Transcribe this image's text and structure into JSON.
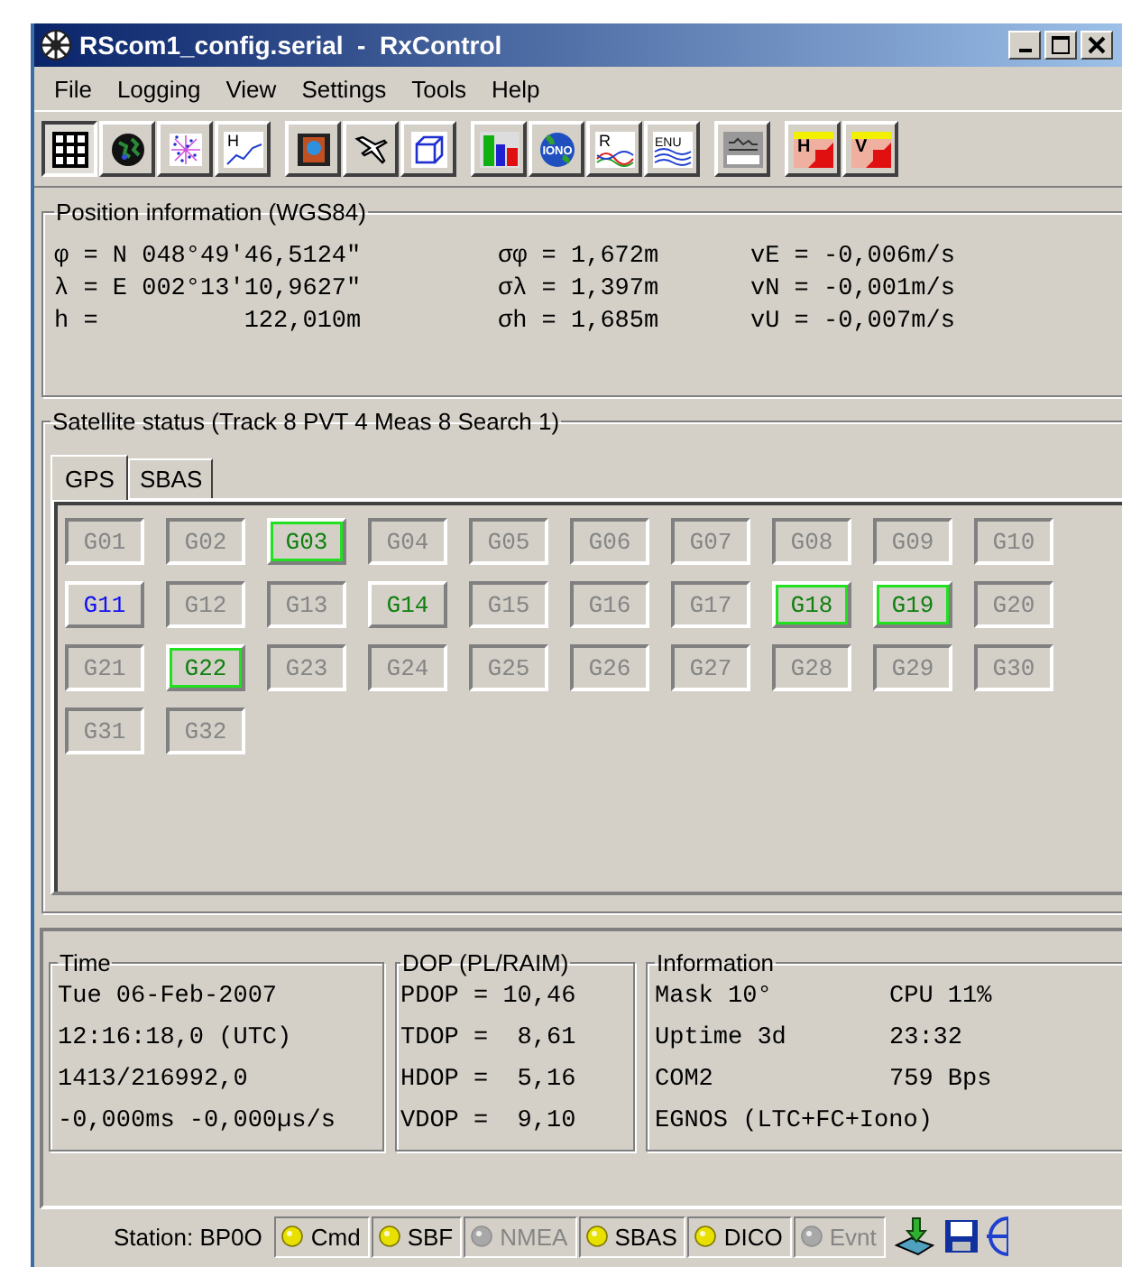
{
  "window": {
    "title": "RScom1_config.serial  -  RxControl"
  },
  "menu": [
    "File",
    "Logging",
    "View",
    "Settings",
    "Tools",
    "Help"
  ],
  "toolbar": [
    [
      {
        "kind": "grid",
        "selected": true
      },
      {
        "kind": "globe",
        "selected": false
      },
      {
        "kind": "skyplot",
        "selected": false
      },
      {
        "kind": "hplot",
        "label": "H",
        "selected": false
      }
    ],
    [
      {
        "kind": "film",
        "selected": false
      },
      {
        "kind": "plane",
        "selected": false
      },
      {
        "kind": "cube",
        "selected": false
      }
    ],
    [
      {
        "kind": "bars",
        "selected": false
      },
      {
        "kind": "iono",
        "label": "IONO",
        "selected": false
      },
      {
        "kind": "rplot",
        "label": "R",
        "selected": false
      },
      {
        "kind": "enu",
        "label": "ENU",
        "selected": false
      }
    ],
    [
      {
        "kind": "panel",
        "selected": false
      }
    ],
    [
      {
        "kind": "hv",
        "label": "H",
        "selected": false
      },
      {
        "kind": "hv",
        "label": "V",
        "selected": false
      }
    ]
  ],
  "position": {
    "title": "Position information (WGS84)",
    "rows": [
      [
        "φ = N 048°49'46,5124\"",
        "σφ = 1,672m",
        "vE = -0,006m/s"
      ],
      [
        "λ = E 002°13'10,9627\"",
        "σλ = 1,397m",
        "vN = -0,001m/s"
      ],
      [
        "h =          122,010m",
        "σh = 1,685m",
        "vU = -0,007m/s"
      ]
    ]
  },
  "satellite_status": {
    "title": "Satellite status (Track 8  PVT 4  Meas 8  Search 1)",
    "tabs": [
      {
        "label": "GPS",
        "selected": true
      },
      {
        "label": "SBAS",
        "selected": false
      }
    ],
    "satellites": [
      {
        "label": "G01",
        "kind": "idle"
      },
      {
        "label": "G02",
        "kind": "idle"
      },
      {
        "label": "G03",
        "kind": "used"
      },
      {
        "label": "G04",
        "kind": "idle"
      },
      {
        "label": "G05",
        "kind": "idle"
      },
      {
        "label": "G06",
        "kind": "idle"
      },
      {
        "label": "G07",
        "kind": "idle"
      },
      {
        "label": "G08",
        "kind": "idle"
      },
      {
        "label": "G09",
        "kind": "idle"
      },
      {
        "label": "G10",
        "kind": "idle"
      },
      {
        "label": "G11",
        "kind": "search"
      },
      {
        "label": "G12",
        "kind": "idle"
      },
      {
        "label": "G13",
        "kind": "idle"
      },
      {
        "label": "G14",
        "kind": "tracked"
      },
      {
        "label": "G15",
        "kind": "idle"
      },
      {
        "label": "G16",
        "kind": "idle"
      },
      {
        "label": "G17",
        "kind": "idle"
      },
      {
        "label": "G18",
        "kind": "used"
      },
      {
        "label": "G19",
        "kind": "used"
      },
      {
        "label": "G20",
        "kind": "idle"
      },
      {
        "label": "G21",
        "kind": "idle"
      },
      {
        "label": "G22",
        "kind": "used"
      },
      {
        "label": "G23",
        "kind": "idle"
      },
      {
        "label": "G24",
        "kind": "idle"
      },
      {
        "label": "G25",
        "kind": "idle"
      },
      {
        "label": "G26",
        "kind": "idle"
      },
      {
        "label": "G27",
        "kind": "idle"
      },
      {
        "label": "G28",
        "kind": "idle"
      },
      {
        "label": "G29",
        "kind": "idle"
      },
      {
        "label": "G30",
        "kind": "idle"
      },
      {
        "label": "G31",
        "kind": "idle"
      },
      {
        "label": "G32",
        "kind": "idle"
      }
    ]
  },
  "time": {
    "title": "Time",
    "lines": [
      "Tue 06-Feb-2007",
      "12:16:18,0 (UTC)",
      "1413/216992,0",
      "-0,000ms -0,000µs/s"
    ]
  },
  "dop": {
    "title": "DOP (PL/RAIM)",
    "lines": [
      "PDOP = 10,46",
      "TDOP =  8,61",
      "HDOP =  5,16",
      "VDOP =  9,10"
    ]
  },
  "information": {
    "title": "Information",
    "rows": [
      [
        "Mask 10°",
        "CPU 11%"
      ],
      [
        "Uptime 3d",
        "23:32"
      ],
      [
        "COM2",
        "759 Bps"
      ],
      [
        "EGNOS (LTC+FC+Iono)"
      ]
    ]
  },
  "status_bar": {
    "station": "Station: BP0O",
    "indicators": [
      {
        "label": "Cmd",
        "on": true
      },
      {
        "label": "SBF",
        "on": true
      },
      {
        "label": "NMEA",
        "on": false
      },
      {
        "label": "SBAS",
        "on": true
      },
      {
        "label": "DICO",
        "on": true
      },
      {
        "label": "Evnt",
        "on": false
      }
    ]
  }
}
